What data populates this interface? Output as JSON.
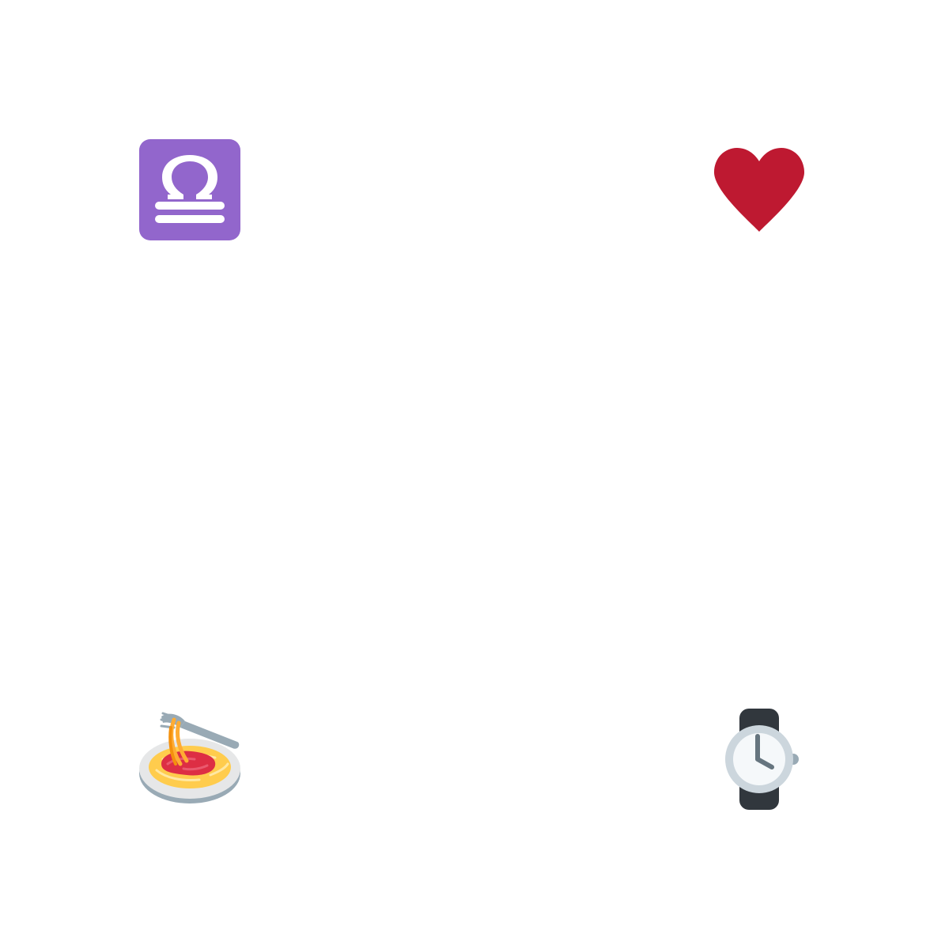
{
  "icons": [
    {
      "name": "libra-icon",
      "colors": {
        "background": "#9266CC",
        "glyph": "#FFFFFF"
      }
    },
    {
      "name": "heart-icon",
      "colors": {
        "fill": "#BE1931"
      }
    },
    {
      "name": "spaghetti-icon",
      "colors": {
        "plate": "#E6E7E8",
        "plate_shadow": "#99AAB5",
        "pasta": "#FFCC4D",
        "sauce": "#DD2E44",
        "fork": "#99AAB5"
      }
    },
    {
      "name": "watch-icon",
      "colors": {
        "strap": "#31373D",
        "case": "#CCD6DD",
        "face": "#F5F8FA",
        "hands": "#66757F"
      }
    }
  ]
}
